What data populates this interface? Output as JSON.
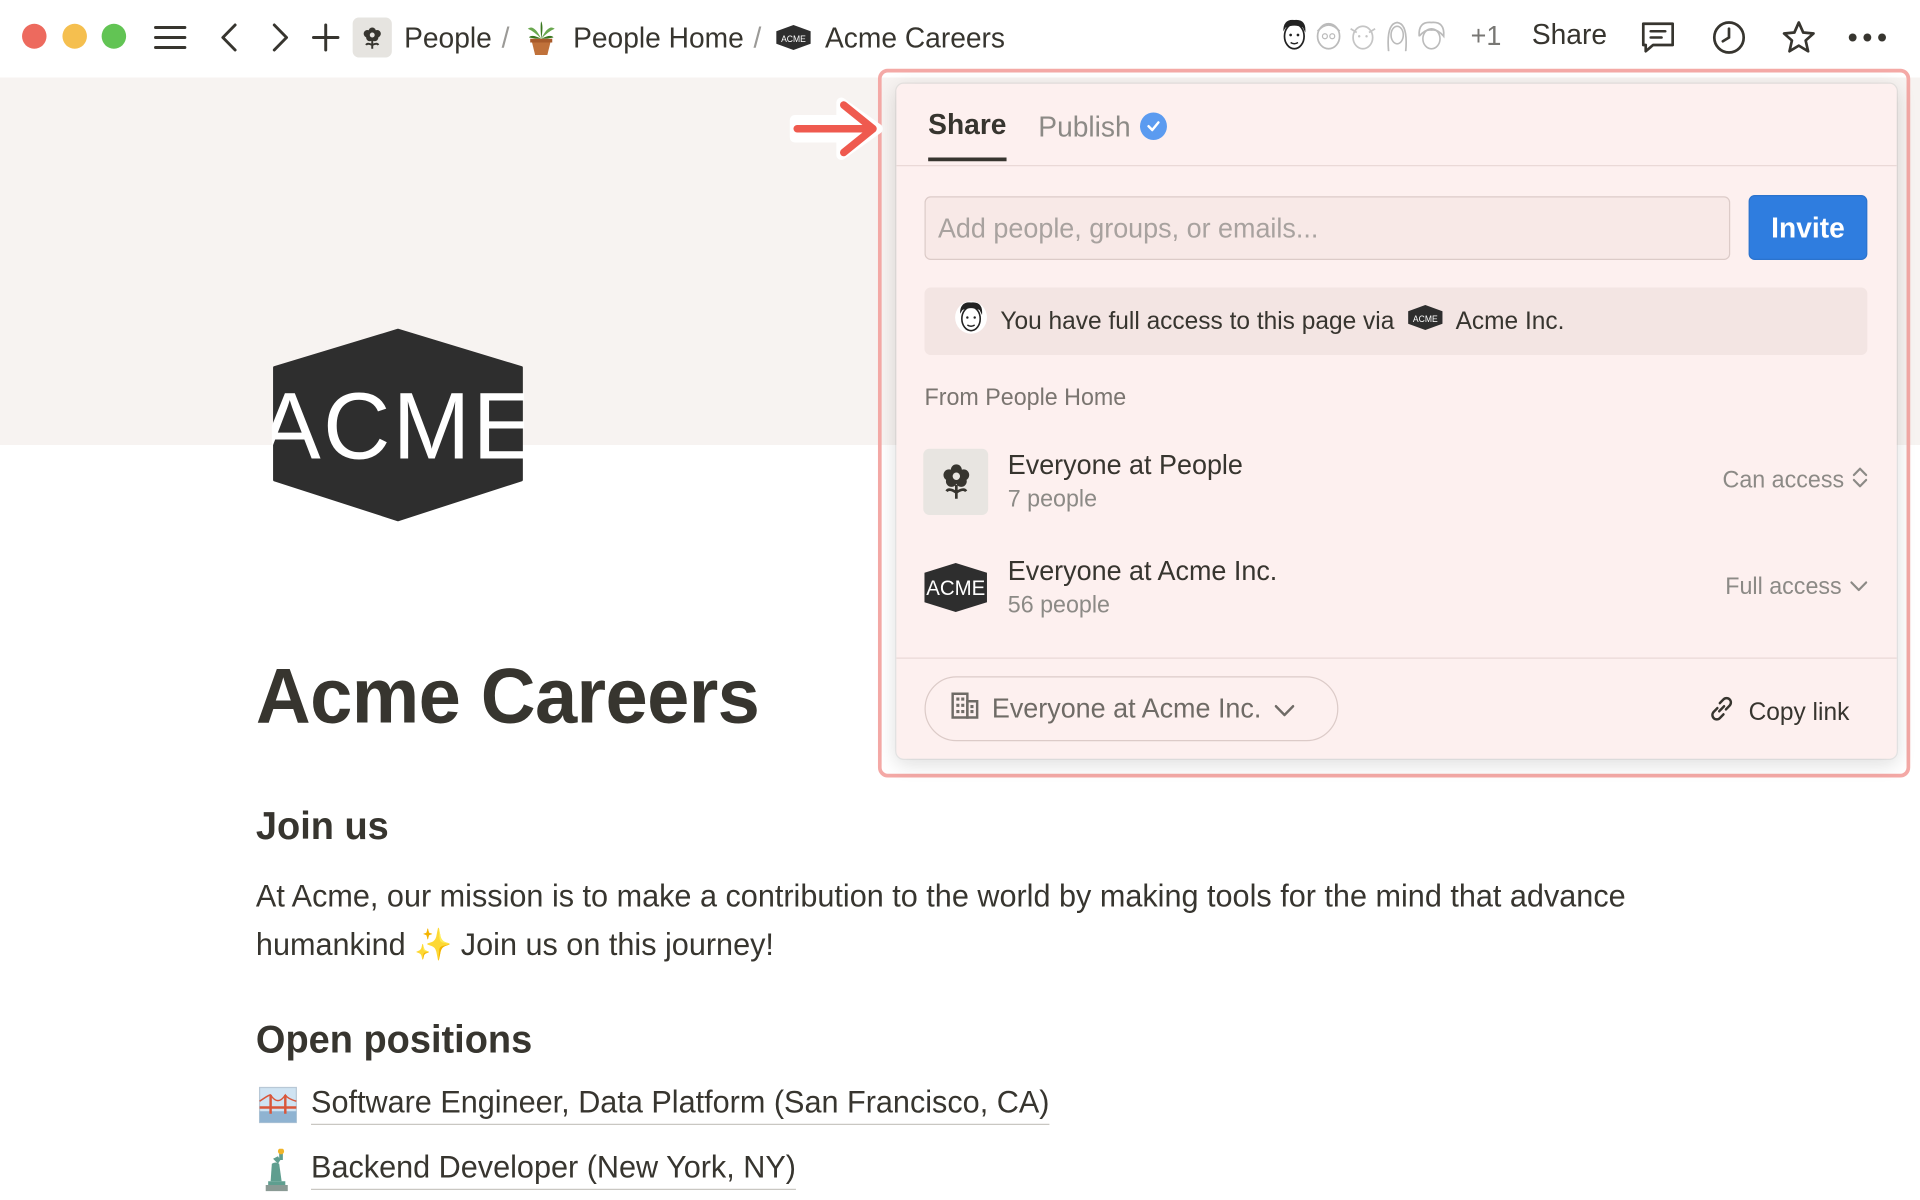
{
  "topbar": {
    "breadcrumbs": [
      {
        "label": "People",
        "icon": "flower-icon"
      },
      {
        "label": "People Home",
        "icon": "potted-plant-icon"
      },
      {
        "label": "Acme Careers",
        "icon": "acme-logo-icon"
      }
    ],
    "separator": "/",
    "collaborators_more": "+1",
    "share_label": "Share"
  },
  "page": {
    "title": "Acme Careers",
    "logo_text": "ACME",
    "sections": {
      "join_heading": "Join us",
      "join_text": "At Acme, our mission is to make a contribution to the world by making tools for the mind that advance humankind ✨ Join us on this journey!",
      "positions_heading": "Open positions"
    },
    "positions": [
      {
        "label": "Software Engineer, Data Platform (San Francisco, CA)",
        "icon": "golden-gate-icon"
      },
      {
        "label": "Backend Developer (New York, NY)",
        "icon": "statue-of-liberty-icon"
      }
    ]
  },
  "share_popup": {
    "tabs": [
      {
        "label": "Share",
        "active": true
      },
      {
        "label": "Publish",
        "active": false
      }
    ],
    "invite": {
      "placeholder": "Add people, groups, or emails...",
      "button_label": "Invite"
    },
    "access_note": {
      "prefix": "You have full access to this page via",
      "workspace": "Acme Inc.",
      "workspace_badge": "ACME"
    },
    "from_label": "From People Home",
    "members": [
      {
        "name": "Everyone at People",
        "count": "7 people",
        "permission": "Can access"
      },
      {
        "name": "Everyone at Acme Inc.",
        "count": "56 people",
        "permission": "Full access",
        "badge": "ACME"
      }
    ],
    "footer": {
      "scope_label": "Everyone at Acme Inc.",
      "copy_link_label": "Copy link"
    }
  },
  "colors": {
    "accent_blue": "#2f7ddf",
    "highlight_frame": "#f4a9a6",
    "arrow_red": "#ef5a4f",
    "popup_bg": "#fdf0ef",
    "cover_bg": "#f7f3f1"
  }
}
